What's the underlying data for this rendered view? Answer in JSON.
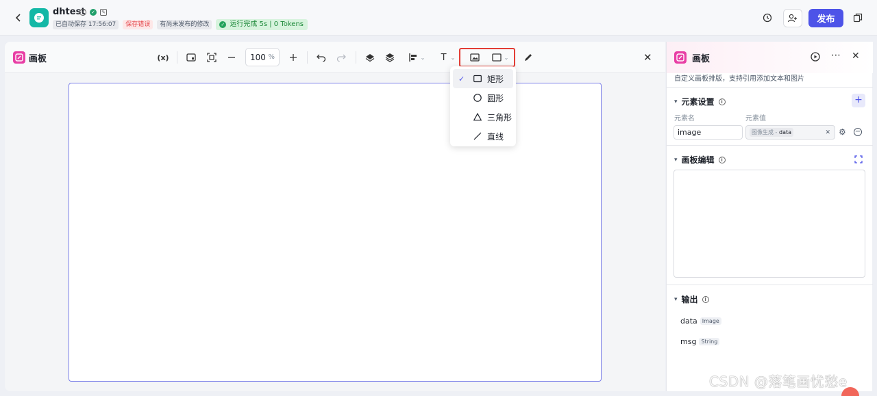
{
  "header": {
    "app_name": "dhtest",
    "autosave": "已自动保存 17:56:07",
    "save_error": "保存错误",
    "unpublished": "有尚未发布的修改",
    "run_status": "运行完成 5s | 0 Tokens",
    "publish_label": "发布"
  },
  "canvas": {
    "title": "画板",
    "variable_btn": "(x)",
    "zoom_value": "100",
    "zoom_unit": "%",
    "text_tool": "T"
  },
  "shape_menu": {
    "items": [
      {
        "label": "矩形",
        "selected": true
      },
      {
        "label": "圆形",
        "selected": false
      },
      {
        "label": "三角形",
        "selected": false
      },
      {
        "label": "直线",
        "selected": false
      }
    ]
  },
  "side": {
    "title": "画板",
    "description": "自定义画板排版，支持引用添加文本和图片",
    "elements_section": "元素设置",
    "col_name": "元素名",
    "col_value": "元素值",
    "element_name": "image",
    "element_value_source": "图像生成 -",
    "element_value_field": "data",
    "editor_section": "画板编辑",
    "output_section": "输出",
    "outputs": [
      {
        "name": "data",
        "type": "Image"
      },
      {
        "name": "msg",
        "type": "String"
      }
    ]
  },
  "watermark": "CSDN @落笔画忧愁e",
  "colors": {
    "brand": "#4d53e8",
    "app_logo": "#14b8a6",
    "panel_icon": "#e83fa5",
    "highlight_box": "#e33d35",
    "run_ok": "#22a35a"
  }
}
